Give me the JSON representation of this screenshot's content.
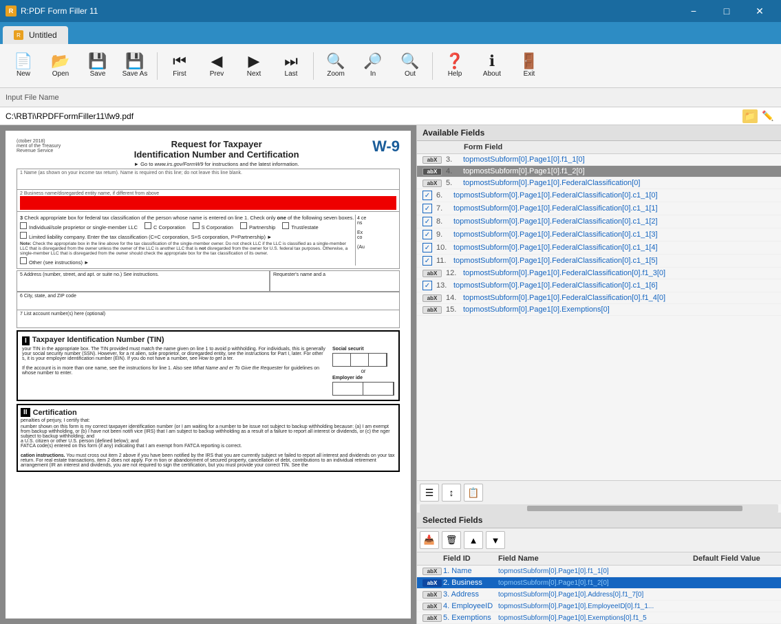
{
  "titlebar": {
    "app_title": "R:PDF Form Filler 11",
    "tab_title": "Untitled"
  },
  "toolbar": {
    "buttons": [
      {
        "id": "new",
        "label": "New",
        "icon": "📄"
      },
      {
        "id": "open",
        "label": "Open",
        "icon": "📂"
      },
      {
        "id": "save",
        "label": "Save",
        "icon": "💾"
      },
      {
        "id": "save-as",
        "label": "Save As",
        "icon": "💾"
      },
      {
        "id": "first",
        "label": "First",
        "icon": "⏮"
      },
      {
        "id": "prev",
        "label": "Prev",
        "icon": "◀"
      },
      {
        "id": "next",
        "label": "Next",
        "icon": "▶"
      },
      {
        "id": "last",
        "label": "Last",
        "icon": "⏭"
      },
      {
        "id": "zoom",
        "label": "Zoom",
        "icon": "🔍"
      },
      {
        "id": "in",
        "label": "In",
        "icon": "🔎"
      },
      {
        "id": "out",
        "label": "Out",
        "icon": "🔍"
      },
      {
        "id": "help",
        "label": "Help",
        "icon": "❓"
      },
      {
        "id": "about",
        "label": "About",
        "icon": "ℹ"
      },
      {
        "id": "exit",
        "label": "Exit",
        "icon": "🚪"
      }
    ]
  },
  "input_bar": {
    "label": "Input File Name"
  },
  "filepath": {
    "value": "C:\\RBTi\\RPDFFormFiller11\\fw9.pdf"
  },
  "available_fields": {
    "header": "Available Fields",
    "col_type": "Form Field",
    "rows": [
      {
        "num": "3.",
        "type": "abX",
        "is_check": false,
        "name": "topmostSubform[0].Page1[0].f1_1[0]"
      },
      {
        "num": "4.",
        "type": "abX",
        "is_check": false,
        "name": "topmostSubform[0].Page1[0].f1_2[0]",
        "selected": true
      },
      {
        "num": "5.",
        "type": "abX",
        "is_check": false,
        "name": "topmostSubform[0].Page1[0].FederalClassification[0]"
      },
      {
        "num": "6.",
        "type": "chk",
        "is_check": true,
        "name": "topmostSubform[0].Page1[0].FederalClassification[0].c1_1[0]"
      },
      {
        "num": "7.",
        "type": "chk",
        "is_check": true,
        "name": "topmostSubform[0].Page1[0].FederalClassification[0].c1_1[1]"
      },
      {
        "num": "8.",
        "type": "chk",
        "is_check": true,
        "name": "topmostSubform[0].Page1[0].FederalClassification[0].c1_1[2]"
      },
      {
        "num": "9.",
        "type": "chk",
        "is_check": true,
        "name": "topmostSubform[0].Page1[0].FederalClassification[0].c1_1[3]"
      },
      {
        "num": "10.",
        "type": "chk",
        "is_check": true,
        "name": "topmostSubform[0].Page1[0].FederalClassification[0].c1_1[4]"
      },
      {
        "num": "11.",
        "type": "chk",
        "is_check": true,
        "name": "topmostSubform[0].Page1[0].FederalClassification[0].c1_1[5]"
      },
      {
        "num": "12.",
        "type": "abX",
        "is_check": false,
        "name": "topmostSubform[0].Page1[0].FederalClassification[0].f1_3[0]"
      },
      {
        "num": "13.",
        "type": "chk",
        "is_check": true,
        "name": "topmostSubform[0].Page1[0].FederalClassification[0].c1_1[6]"
      },
      {
        "num": "14.",
        "type": "abX",
        "is_check": false,
        "name": "topmostSubform[0].Page1[0].FederalClassification[0].f1_4[0]"
      },
      {
        "num": "15.",
        "type": "abX",
        "is_check": false,
        "name": "topmostSubform[0].Page1[0].Exemptions[0]"
      }
    ]
  },
  "selected_fields": {
    "header": "Selected Fields",
    "col_type": "",
    "col_field_id": "Field ID",
    "col_field_name": "Field Name",
    "col_default": "Default Field Value",
    "rows": [
      {
        "num": "1.",
        "type": "abX",
        "field_id": "Name",
        "field_name": "topmostSubform[0].Page1[0].f1_1[0]",
        "default": ""
      },
      {
        "num": "2.",
        "type": "abX",
        "field_id": "Business",
        "field_name": "topmostSubform[0].Page1[0].f1_2[0]",
        "default": "",
        "active": true
      },
      {
        "num": "3.",
        "type": "abX",
        "field_id": "Address",
        "field_name": "topmostSubform[0].Page1[0].Address[0].f1_7[0]",
        "default": ""
      },
      {
        "num": "4.",
        "type": "abX",
        "field_id": "EmployeeID",
        "field_name": "topmostSubform[0].Page1[0].EmployeeID[0].f1_1...",
        "default": ""
      },
      {
        "num": "5.",
        "type": "abX",
        "field_id": "Exemptions",
        "field_name": "topmostSubform[0].Page1[0].Exemptions[0].f1_5",
        "default": ""
      }
    ]
  },
  "pdf": {
    "form_number": "W-9",
    "title": "Request for Taxpayer",
    "title2": "Identification Number and Certification",
    "subtitle": "► Go to www.irs.gov/FormW9 for instructions and the latest information.",
    "irs_label": "rev_oct_2018",
    "dept_label": "ment of the Treasury",
    "revenue_label": "Revenue Service",
    "line1_label": "1  Name (as shown on your income tax return). Name is required on this line; do not leave this line blank.",
    "line2_label": "2  Business name/disregarded entity name, if different from above",
    "line3_label": "3  Check appropriate box for federal tax classification of the person whose name is entered on line 1. Check only one of the following seven boxes.",
    "tin_title": "Taxpayer Identification Number (TIN)",
    "tin_desc1": "your TIN in the appropriate box. The TIN provided must match the name given on line 1 to avoid",
    "ssn_label": "Social security",
    "ein_label": "Employer ide",
    "cert_title": "Certification",
    "cert_desc": "penalties of perjury, I certify that:",
    "address_label": "5  Address (number, street, and apt. or suite no.) See instructions.",
    "city_label": "6  City, state, and ZIP code",
    "account_label": "7  List account number(s) here (optional)"
  }
}
